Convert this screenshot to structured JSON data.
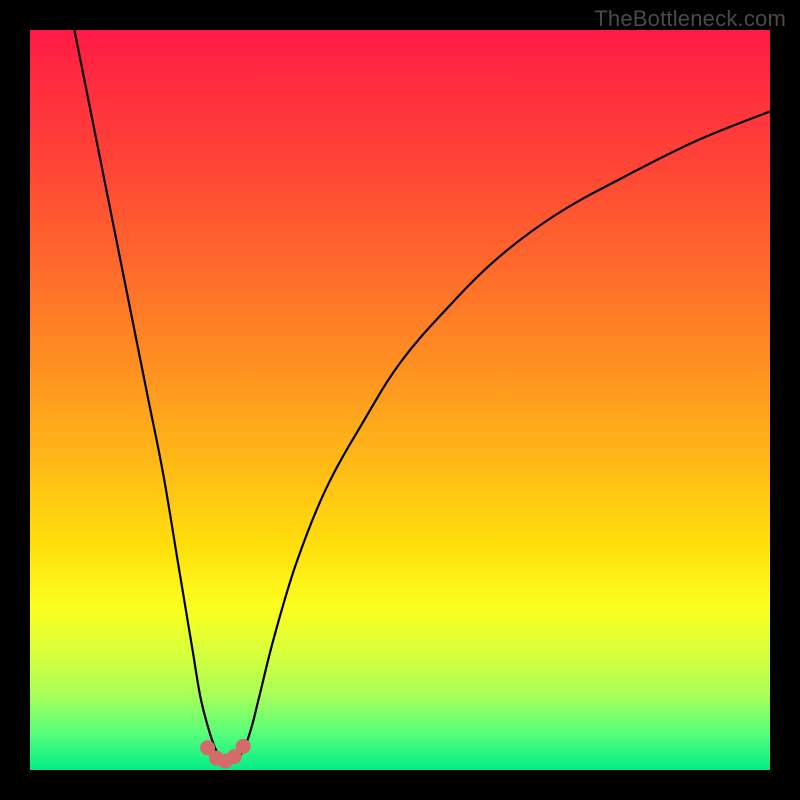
{
  "watermark": "TheBottleneck.com",
  "chart_data": {
    "type": "line",
    "title": "",
    "xlabel": "",
    "ylabel": "",
    "xlim": [
      0,
      100
    ],
    "ylim": [
      0,
      100
    ],
    "grid": false,
    "legend": false,
    "series": [
      {
        "name": "bottleneck-curve",
        "x": [
          6,
          8,
          10,
          12,
          14,
          16,
          18,
          20,
          21,
          22,
          23,
          24,
          25,
          26,
          27,
          28,
          29,
          30,
          31,
          33,
          36,
          40,
          45,
          50,
          56,
          63,
          71,
          80,
          90,
          100
        ],
        "y": [
          100,
          90,
          80,
          70,
          60,
          50,
          40,
          28,
          22,
          16,
          10,
          6,
          3,
          1.5,
          1,
          1.5,
          3,
          6,
          10,
          18,
          28,
          38,
          47,
          55,
          62,
          69,
          75,
          80,
          85,
          89
        ]
      },
      {
        "name": "bottleneck-markers",
        "x": [
          24.0,
          25.2,
          26.4,
          27.6,
          28.8
        ],
        "y": [
          3.0,
          1.6,
          1.2,
          1.8,
          3.2
        ]
      }
    ],
    "background_gradient": {
      "stops": [
        {
          "pos": 0.0,
          "color": "#ff1a46"
        },
        {
          "pos": 0.18,
          "color": "#ff4436"
        },
        {
          "pos": 0.45,
          "color": "#ff8f22"
        },
        {
          "pos": 0.7,
          "color": "#ffe00c"
        },
        {
          "pos": 0.84,
          "color": "#daff3a"
        },
        {
          "pos": 1.0,
          "color": "#00ef86"
        }
      ]
    }
  }
}
